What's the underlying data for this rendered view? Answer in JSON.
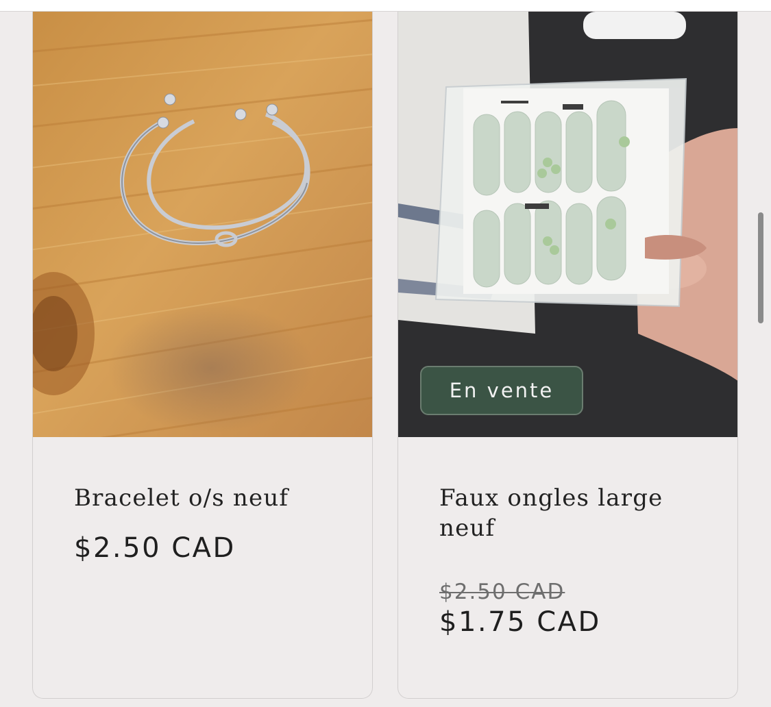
{
  "products": [
    {
      "title": "Bracelet o/s neuf",
      "price": "$2.50 CAD",
      "image": "silver-bracelets-on-wood-table"
    },
    {
      "title": "Faux ongles large neuf",
      "badge": "En vente",
      "compare_price": "$2.50 CAD",
      "sale_price": "$1.75 CAD",
      "image": "press-on-nails-package-in-hand"
    }
  ],
  "colors": {
    "page_background": "#efecec",
    "badge_background": "#3b5445",
    "text": "#222222",
    "strikethrough_text": "#6e6e6e"
  }
}
